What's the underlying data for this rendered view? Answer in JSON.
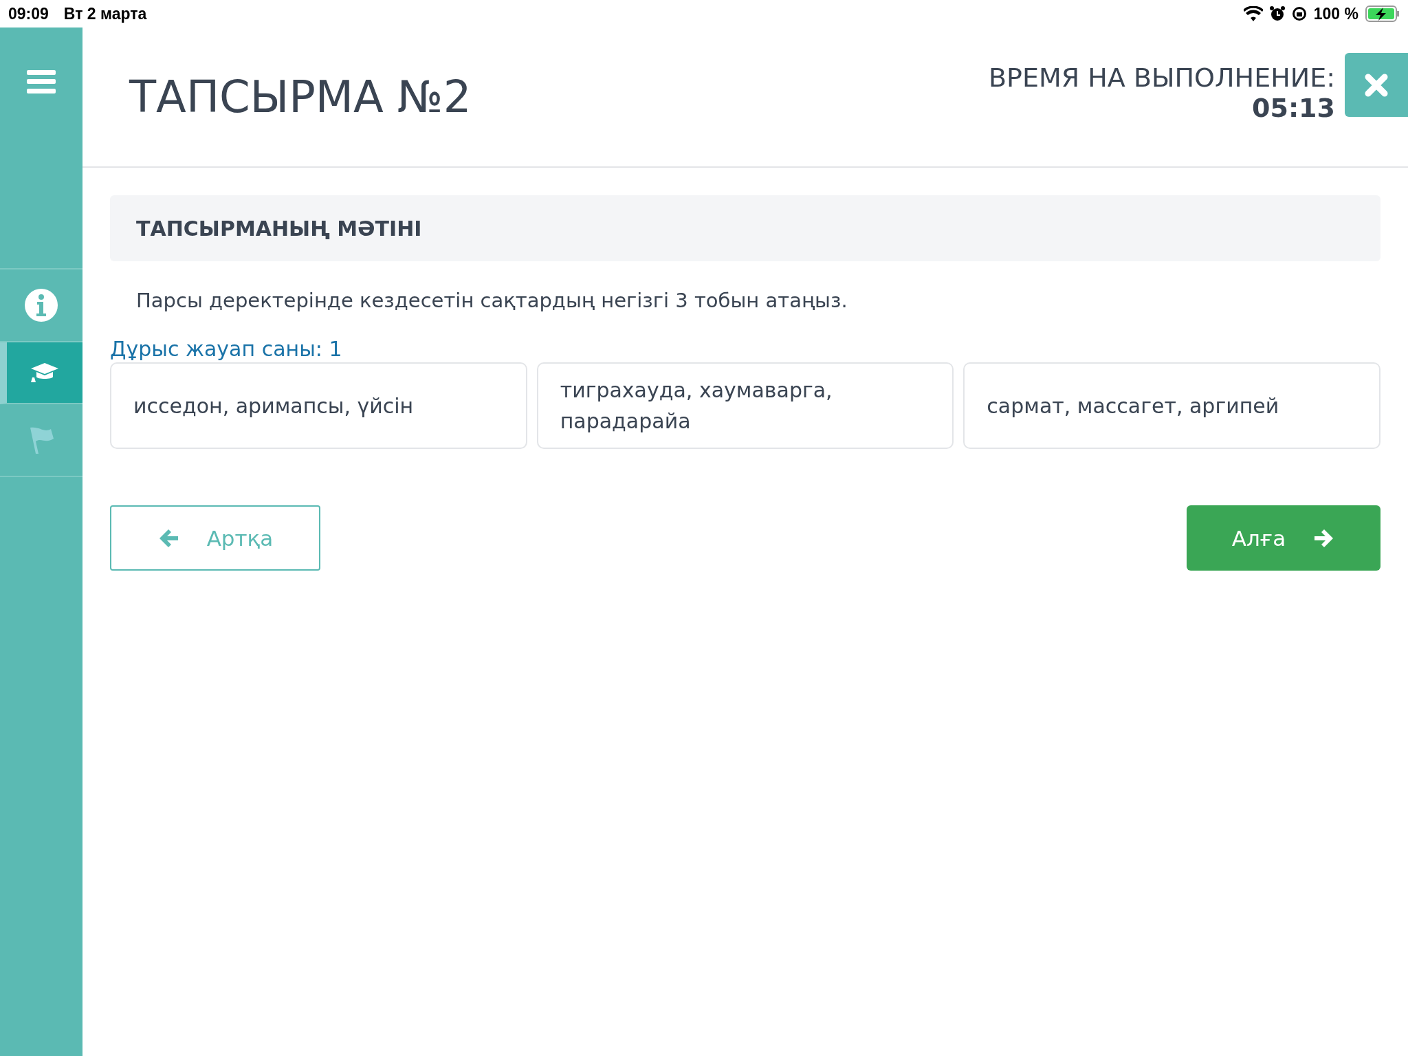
{
  "status_bar": {
    "time": "09:09",
    "date": "Вт 2 марта",
    "battery": "100 %"
  },
  "sidebar": {
    "items": [
      {
        "kind": "info",
        "selected": false,
        "disabled": false
      },
      {
        "kind": "course",
        "selected": true,
        "disabled": false
      },
      {
        "kind": "flag",
        "selected": false,
        "disabled": true
      }
    ]
  },
  "header": {
    "title": "ТАПСЫРМА №2",
    "timer_label": "ВРЕМЯ НА ВЫПОЛНЕНИЕ:",
    "timer_value": "05:13"
  },
  "task": {
    "heading": "ТАПСЫРМАНЫҢ МӘТІНІ",
    "question": "Парсы деректерінде кездесетін сақтардың негізгі 3 тобын атаңыз.",
    "answer_count": "Дұрыс жауап саны: 1"
  },
  "answers": [
    {
      "text": "исседон, аримапсы, үйсін",
      "selected": false
    },
    {
      "text": "тиграхауда, хаумаварга, парадарайа",
      "selected": false
    },
    {
      "text": "сармат, массагет, аргипей",
      "selected": false
    }
  ],
  "buttons": {
    "back": "Артқа",
    "next": "Алға"
  }
}
